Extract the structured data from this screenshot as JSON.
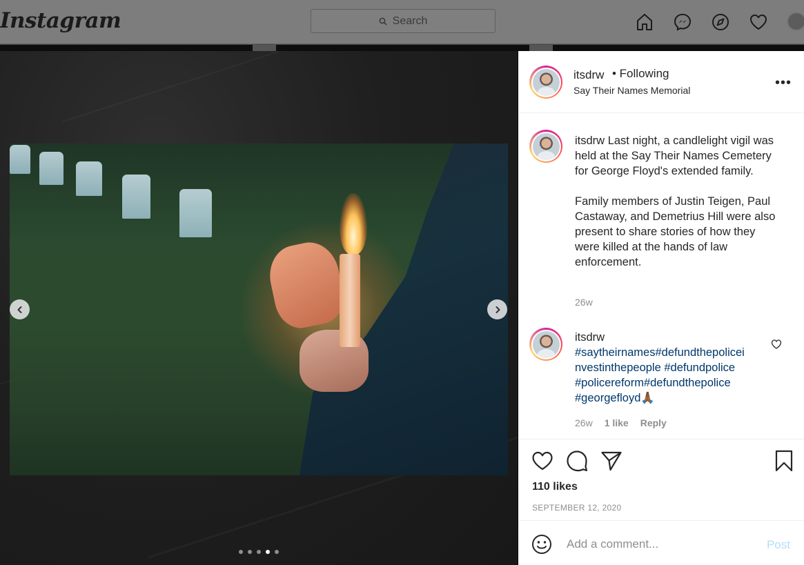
{
  "topbar": {
    "logo": "Instagram",
    "search_placeholder": "Search",
    "icons": [
      "home-icon",
      "messenger-icon",
      "explore-icon",
      "activity-heart-icon",
      "profile-avatar"
    ]
  },
  "media": {
    "slide_count": 5,
    "active_slide": 4,
    "icons": [
      "chevron-left-icon",
      "chevron-right-icon"
    ]
  },
  "post": {
    "username": "itsdrw",
    "follow_status": "• Following",
    "location": "Say Their Names Memorial",
    "more_icon": "more-options-icon",
    "caption": {
      "username": "itsdrw",
      "text_p1": "Last night, a candlelight vigil was held at the Say Their Names Cemetery for George Floyd's extended family.",
      "text_p2": "Family members of Justin Teigen, Paul Castaway, and Demetrius Hill were also present to share stories of how they were killed at the hands of law enforcement.",
      "time": "26w"
    },
    "comment": {
      "username": "itsdrw",
      "hashtags_line1": "#saytheirnames#defundthepolicei",
      "hashtags_line2": "nvestinthepeople #defundpolice",
      "hashtags_line3": "#policereform#defundthepolice",
      "hashtags_line4": "#georgefloyd🙏🏾",
      "time": "26w",
      "likes": "1 like",
      "reply": "Reply"
    },
    "likes": "110 likes",
    "date": "SEPTEMBER 12, 2020",
    "add_comment_placeholder": "Add a comment...",
    "post_label": "Post"
  },
  "colors": {
    "link": "#00376b",
    "muted": "#8e8e8e",
    "post_disabled": "#b2dffc"
  }
}
